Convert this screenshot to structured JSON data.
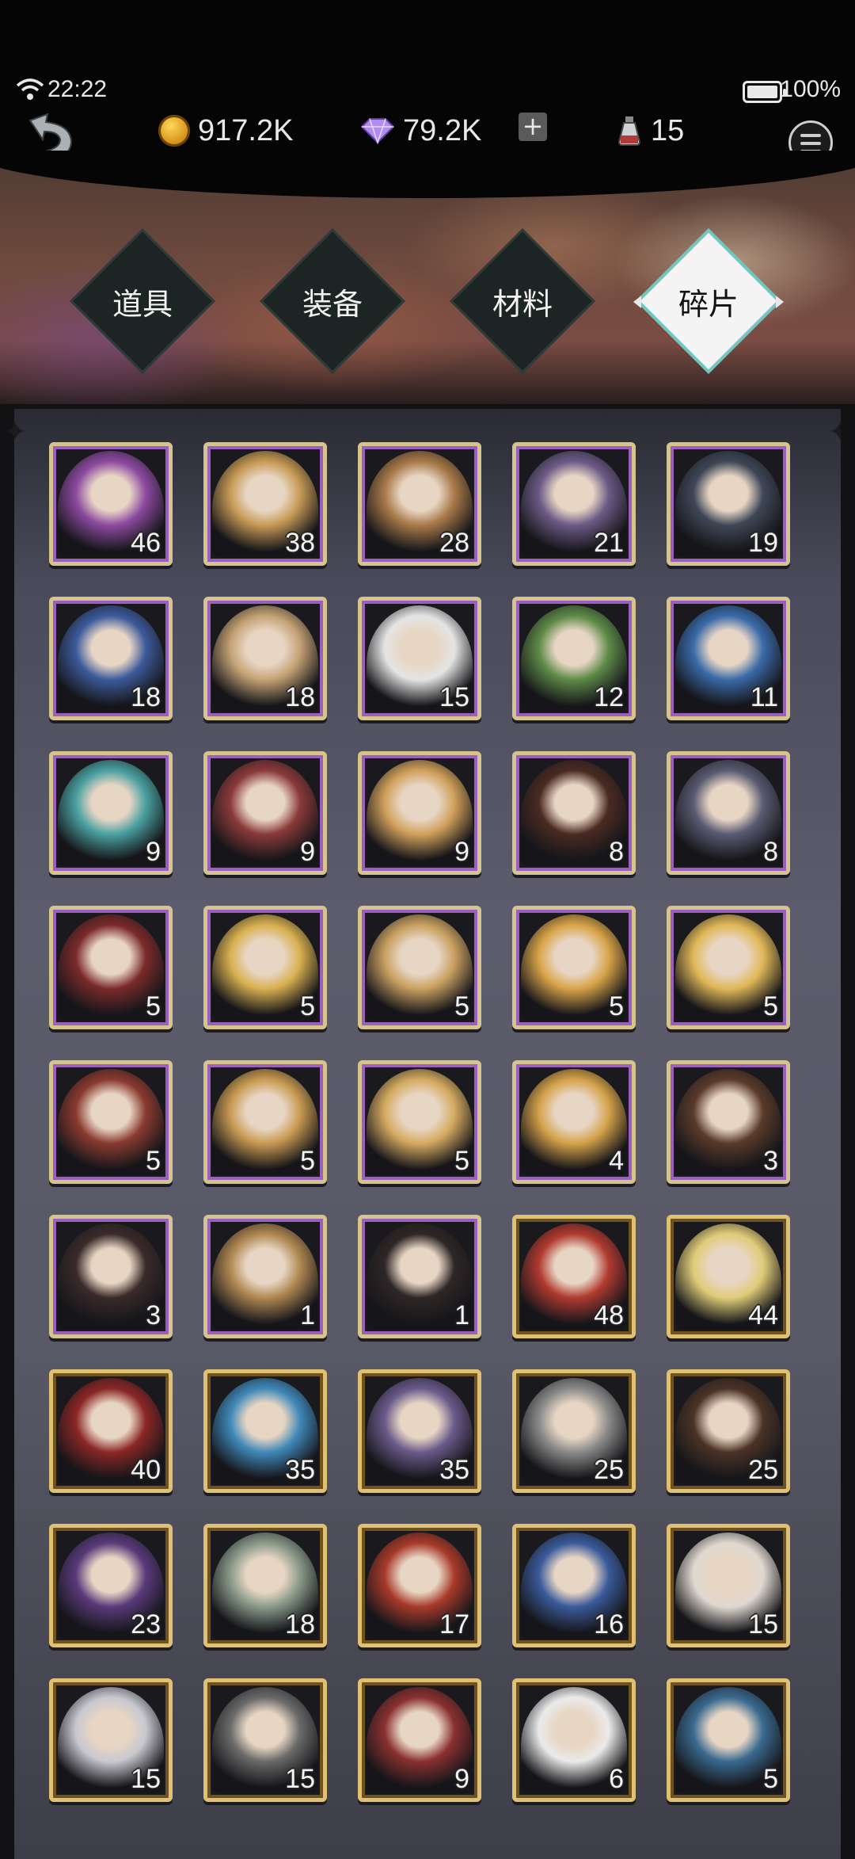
{
  "status": {
    "time": "22:22",
    "battery": "100%"
  },
  "resources": {
    "gold": "917.2K",
    "gems": "79.2K",
    "potion": "15"
  },
  "tabs": [
    {
      "label": "道具",
      "active": false
    },
    {
      "label": "装备",
      "active": false
    },
    {
      "label": "材料",
      "active": false
    },
    {
      "label": "碎片",
      "active": true
    }
  ],
  "colors": {
    "accent": "#6fc7c0",
    "frame_gold": "#d8c082",
    "panel": "#585866"
  },
  "items": [
    {
      "count": "46",
      "frame": "purple",
      "tint": "#8c4aa0"
    },
    {
      "count": "38",
      "frame": "purple",
      "tint": "#c69a55"
    },
    {
      "count": "28",
      "frame": "purple",
      "tint": "#a87a48"
    },
    {
      "count": "21",
      "frame": "purple",
      "tint": "#6c5a86"
    },
    {
      "count": "19",
      "frame": "purple",
      "tint": "#3e4656"
    },
    {
      "count": "18",
      "frame": "purple",
      "tint": "#3c5a9a"
    },
    {
      "count": "18",
      "frame": "purple",
      "tint": "#c4a274"
    },
    {
      "count": "15",
      "frame": "purple",
      "tint": "#e4e4e4"
    },
    {
      "count": "12",
      "frame": "purple",
      "tint": "#5e8a48"
    },
    {
      "count": "11",
      "frame": "purple",
      "tint": "#3a6aa8"
    },
    {
      "count": "9",
      "frame": "purple",
      "tint": "#4aa0a0"
    },
    {
      "count": "9",
      "frame": "purple",
      "tint": "#8a3a3a"
    },
    {
      "count": "9",
      "frame": "purple",
      "tint": "#d0a05a"
    },
    {
      "count": "8",
      "frame": "purple",
      "tint": "#4a2a22"
    },
    {
      "count": "8",
      "frame": "purple",
      "tint": "#5a5a72"
    },
    {
      "count": "5",
      "frame": "purple",
      "tint": "#7a2a2a"
    },
    {
      "count": "5",
      "frame": "purple",
      "tint": "#d8b050"
    },
    {
      "count": "5",
      "frame": "purple",
      "tint": "#c8a060"
    },
    {
      "count": "5",
      "frame": "purple",
      "tint": "#d8a448"
    },
    {
      "count": "5",
      "frame": "purple",
      "tint": "#e0b858"
    },
    {
      "count": "5",
      "frame": "purple",
      "tint": "#8a3a30"
    },
    {
      "count": "5",
      "frame": "purple",
      "tint": "#c89a52"
    },
    {
      "count": "5",
      "frame": "purple",
      "tint": "#d4aa60"
    },
    {
      "count": "4",
      "frame": "purple",
      "tint": "#d4a24a"
    },
    {
      "count": "3",
      "frame": "purple",
      "tint": "#5a3a2a"
    },
    {
      "count": "3",
      "frame": "purple",
      "tint": "#3a2a2a"
    },
    {
      "count": "1",
      "frame": "purple",
      "tint": "#b08852"
    },
    {
      "count": "1",
      "frame": "purple",
      "tint": "#2e2626"
    },
    {
      "count": "48",
      "frame": "gold",
      "tint": "#b03a30"
    },
    {
      "count": "44",
      "frame": "gold",
      "tint": "#e0cc78"
    },
    {
      "count": "40",
      "frame": "gold",
      "tint": "#8a2626"
    },
    {
      "count": "35",
      "frame": "gold",
      "tint": "#3f88b8"
    },
    {
      "count": "35",
      "frame": "gold",
      "tint": "#6a5a8a"
    },
    {
      "count": "25",
      "frame": "gold",
      "tint": "#8a8a8a"
    },
    {
      "count": "25",
      "frame": "gold",
      "tint": "#4a3226"
    },
    {
      "count": "23",
      "frame": "gold",
      "tint": "#5a3a7a"
    },
    {
      "count": "18",
      "frame": "gold",
      "tint": "#8a9a8a"
    },
    {
      "count": "17",
      "frame": "gold",
      "tint": "#a83a2a"
    },
    {
      "count": "16",
      "frame": "gold",
      "tint": "#3a5a9a"
    },
    {
      "count": "15",
      "frame": "gold",
      "tint": "#e0d8d0"
    },
    {
      "count": "15",
      "frame": "gold",
      "tint": "#c8c8d0"
    },
    {
      "count": "15",
      "frame": "gold",
      "tint": "#6a6a6a"
    },
    {
      "count": "9",
      "frame": "gold",
      "tint": "#8a3030"
    },
    {
      "count": "6",
      "frame": "gold",
      "tint": "#eaeaea"
    },
    {
      "count": "5",
      "frame": "gold",
      "tint": "#3a6a90"
    }
  ]
}
